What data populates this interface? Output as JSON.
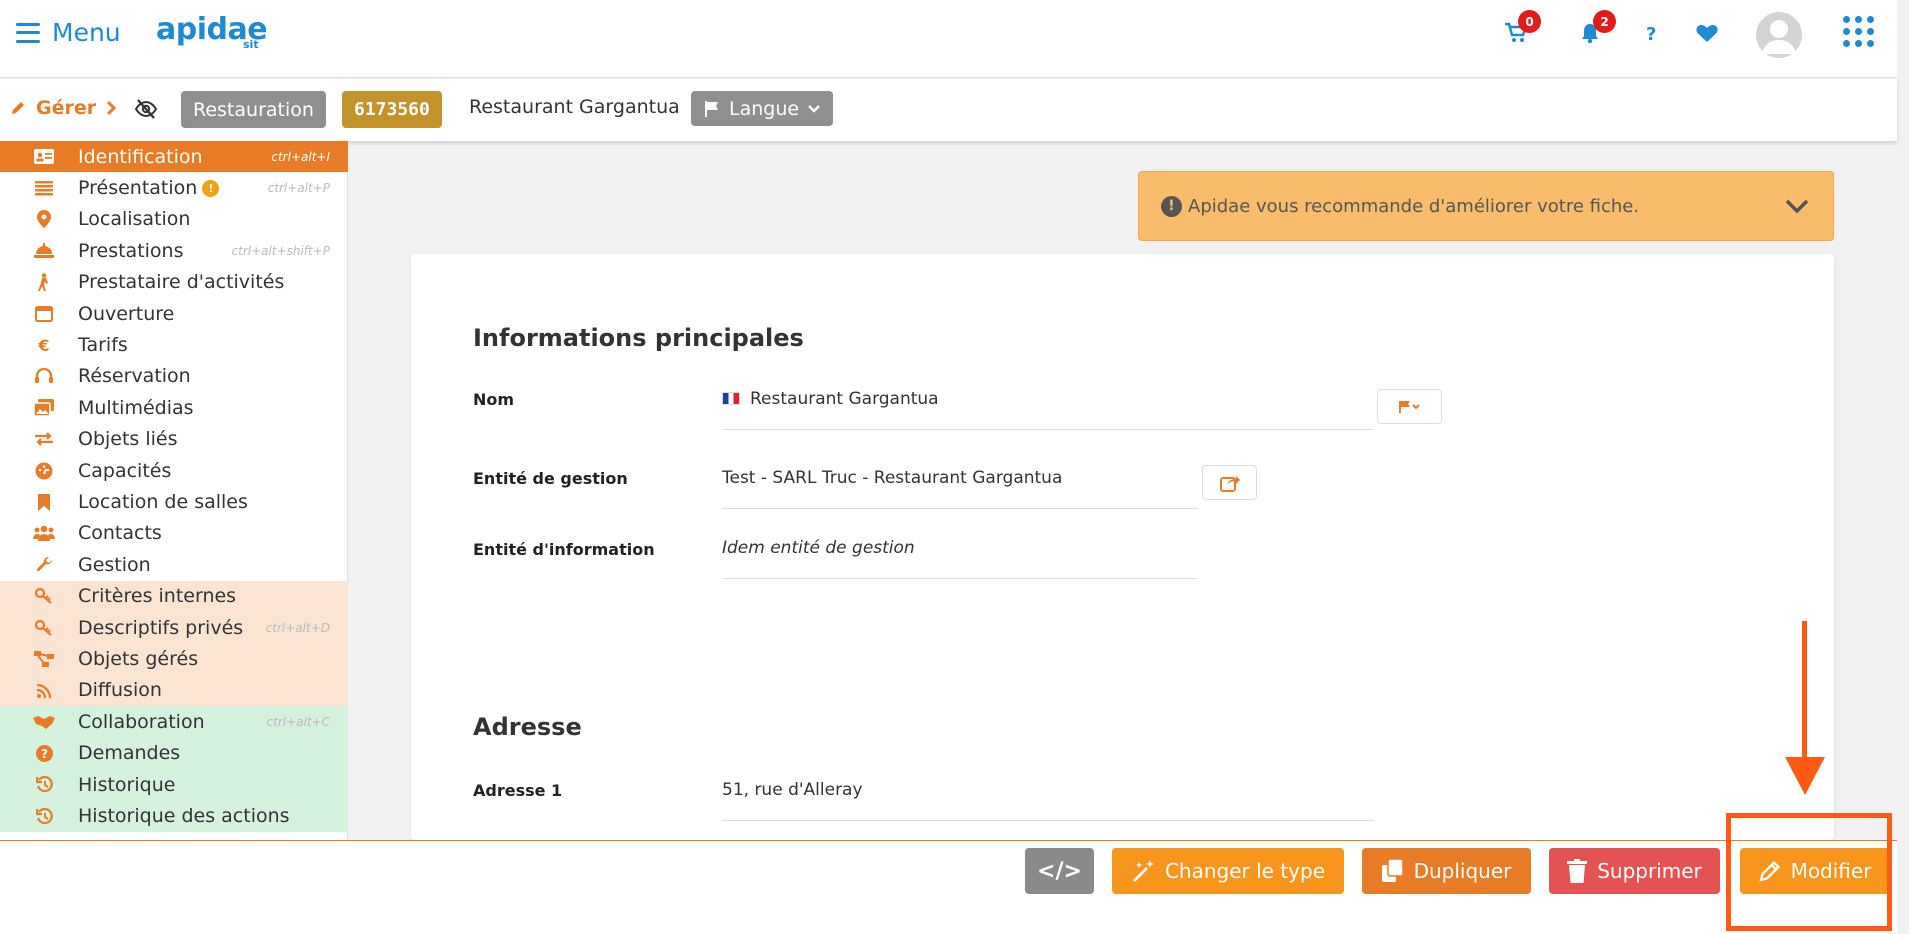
{
  "header": {
    "menu_label": "Menu",
    "logo_text": "apidae",
    "logo_sub": "sit",
    "cart_count": "0",
    "notif_count": "2",
    "help_label": "?"
  },
  "subbar": {
    "gerer_label": "Gérer",
    "type_tag": "Restauration",
    "id_tag": "6173560",
    "title": "Restaurant Gargantua",
    "lang_label": "Langue"
  },
  "sidebar": {
    "items": [
      {
        "label": "Identification",
        "shortcut": "ctrl+alt+I",
        "icon": "id-card-icon"
      },
      {
        "label": "Présentation",
        "shortcut": "ctrl+alt+P",
        "icon": "list-icon",
        "warn": "!"
      },
      {
        "label": "Localisation",
        "shortcut": "",
        "icon": "map-pin-icon"
      },
      {
        "label": "Prestations",
        "shortcut": "ctrl+alt+shift+P",
        "icon": "bell-service-icon"
      },
      {
        "label": "Prestataire d'activités",
        "shortcut": "",
        "icon": "hiker-icon"
      },
      {
        "label": "Ouverture",
        "shortcut": "",
        "icon": "calendar-icon"
      },
      {
        "label": "Tarifs",
        "shortcut": "",
        "icon": "euro-icon"
      },
      {
        "label": "Réservation",
        "shortcut": "",
        "icon": "headset-icon"
      },
      {
        "label": "Multimédias",
        "shortcut": "",
        "icon": "images-icon"
      },
      {
        "label": "Objets liés",
        "shortcut": "",
        "icon": "arrows-exchange-icon"
      },
      {
        "label": "Capacités",
        "shortcut": "",
        "icon": "gauge-icon"
      },
      {
        "label": "Location de salles",
        "shortcut": "",
        "icon": "bookmark-icon"
      },
      {
        "label": "Contacts",
        "shortcut": "",
        "icon": "users-icon"
      },
      {
        "label": "Gestion",
        "shortcut": "",
        "icon": "wrench-icon"
      },
      {
        "label": "Critères internes",
        "shortcut": "",
        "icon": "key-icon"
      },
      {
        "label": "Descriptifs privés",
        "shortcut": "ctrl+alt+D",
        "icon": "key-icon"
      },
      {
        "label": "Objets gérés",
        "shortcut": "",
        "icon": "sitemap-icon"
      },
      {
        "label": "Diffusion",
        "shortcut": "",
        "icon": "rss-icon"
      },
      {
        "label": "Collaboration",
        "shortcut": "ctrl+alt+C",
        "icon": "handshake-icon"
      },
      {
        "label": "Demandes",
        "shortcut": "",
        "icon": "question-circle-icon"
      },
      {
        "label": "Historique",
        "shortcut": "",
        "icon": "history-icon"
      },
      {
        "label": "Historique des actions",
        "shortcut": "",
        "icon": "history-icon"
      }
    ]
  },
  "alert": {
    "icon": "!",
    "text": "Apidae vous recommande d'améliorer votre fiche."
  },
  "main": {
    "section_info": "Informations principales",
    "nom_label": "Nom",
    "nom_value": "Restaurant Gargantua",
    "entite_gestion_label": "Entité de gestion",
    "entite_gestion_value": "Test - SARL Truc - Restaurant Gargantua",
    "entite_info_label": "Entité d'information",
    "entite_info_value": "Idem entité de gestion",
    "section_adresse": "Adresse",
    "adresse1_label": "Adresse 1",
    "adresse1_value": "51, rue d'Alleray"
  },
  "actions": {
    "code_label": "</>",
    "change_type_label": "Changer le type",
    "duplicate_label": "Dupliquer",
    "delete_label": "Supprimer",
    "modify_label": "Modifier"
  },
  "colors": {
    "accent": "#e87b25",
    "brand_blue": "#1d8ad2",
    "annotation": "#ff5a14"
  }
}
